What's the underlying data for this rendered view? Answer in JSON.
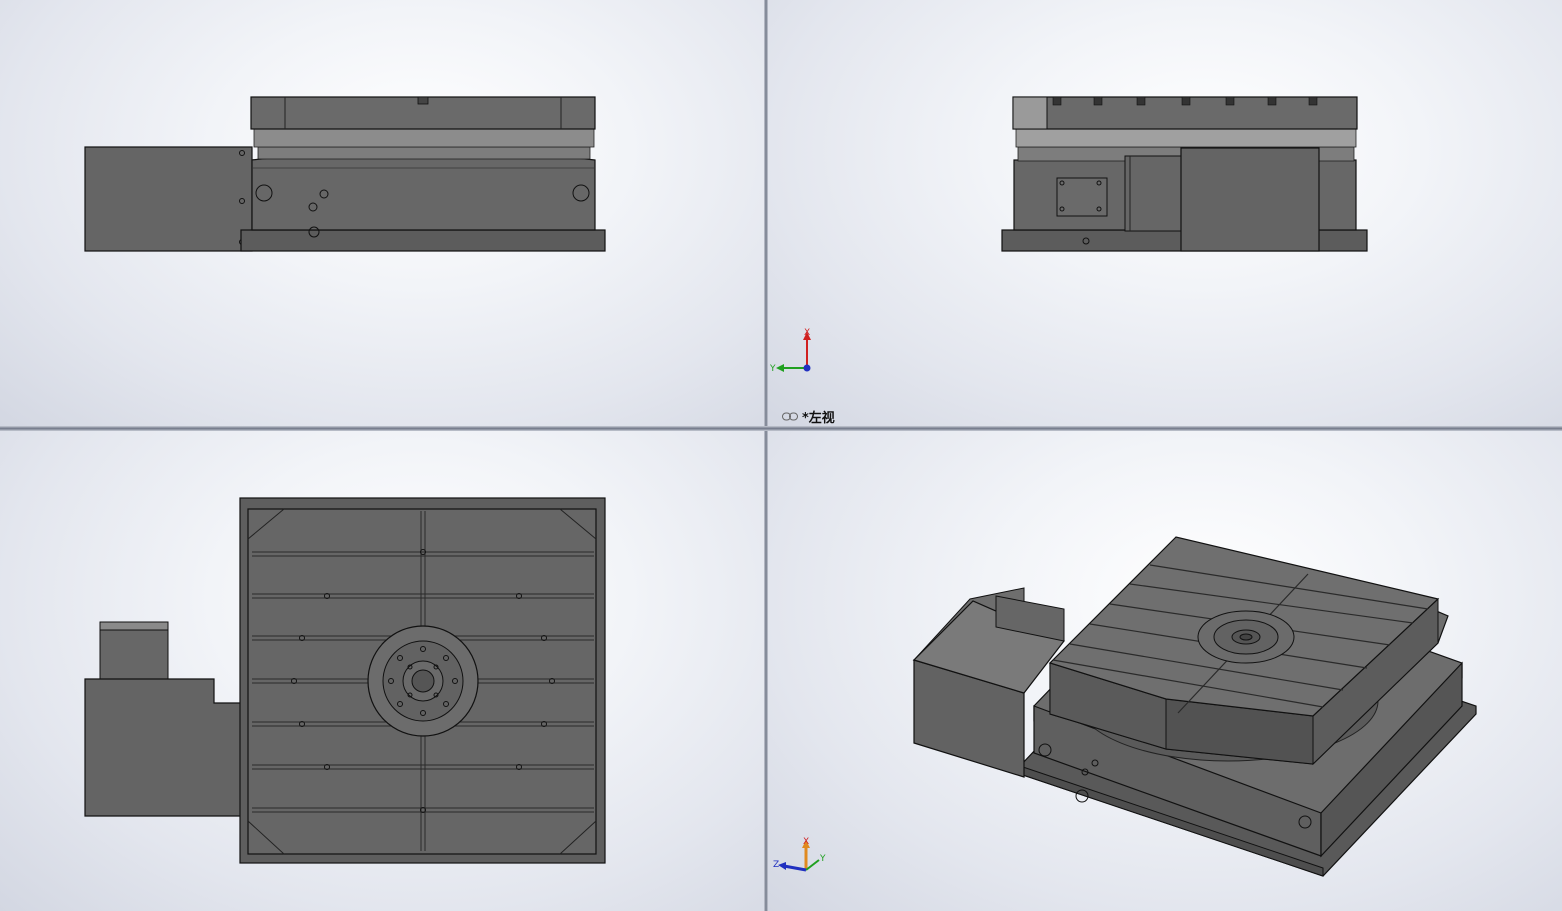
{
  "viewports": {
    "top_left": {
      "name": "front-view"
    },
    "top_right": {
      "name": "left-view",
      "label": "*左视"
    },
    "bottom_left": {
      "name": "top-view"
    },
    "bottom_right": {
      "name": "isometric-view"
    }
  },
  "triads": {
    "left_view": {
      "x": "X",
      "y": "Y"
    },
    "iso_view": {
      "x": "X",
      "y": "Y",
      "z": "Z"
    }
  },
  "colors": {
    "part_fill": "#646464",
    "part_dark": "#4a4a4a",
    "part_light": "#8a8a8a",
    "edge": "#111111",
    "axis_x": "#d02020",
    "axis_y": "#20a020",
    "axis_z": "#2030c0"
  }
}
